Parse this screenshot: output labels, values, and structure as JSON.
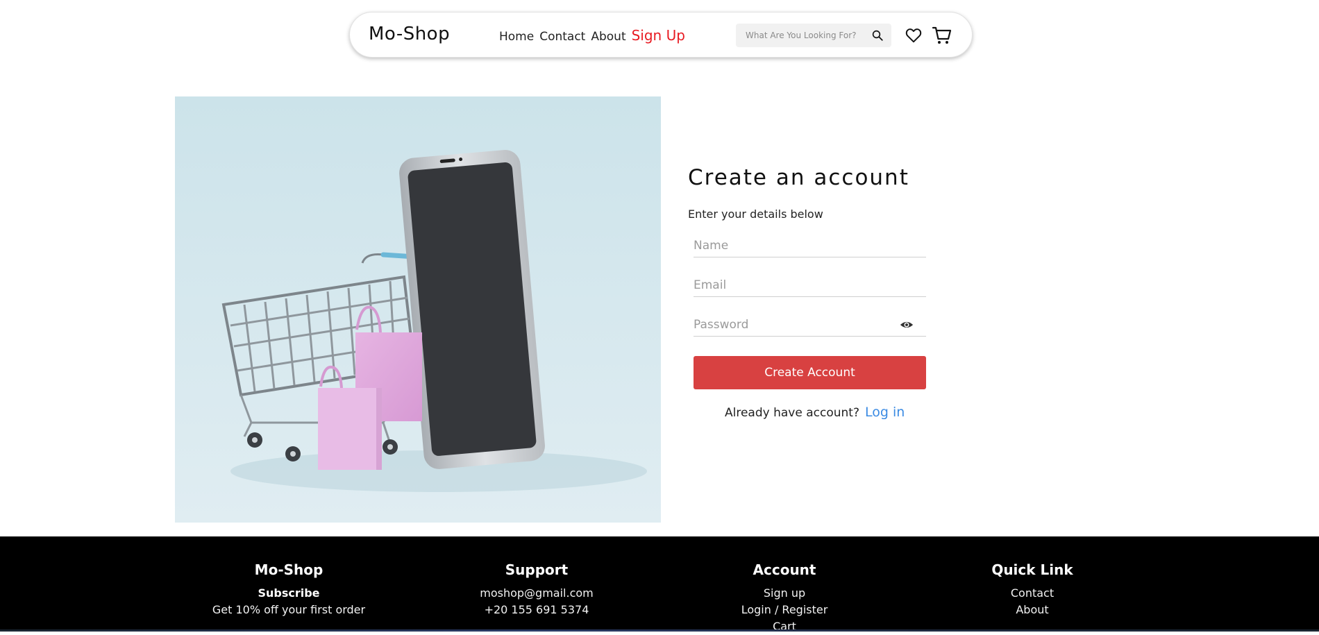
{
  "nav": {
    "brand": "Mo-Shop",
    "links": [
      {
        "label": "Home"
      },
      {
        "label": "Contact"
      },
      {
        "label": "About"
      },
      {
        "label": "Sign Up",
        "active": true
      }
    ],
    "search": {
      "placeholder": "What Are You Looking For?",
      "value": ""
    },
    "icons": [
      "search-icon",
      "heart-icon",
      "cart-icon"
    ]
  },
  "hero": {
    "image_subject": "shopping cart with smartphone and pink shopping bags"
  },
  "form": {
    "title": "Create an account",
    "subtitle": "Enter your details below",
    "fields": {
      "name": {
        "placeholder": "Name",
        "value": ""
      },
      "email": {
        "placeholder": "Email",
        "value": ""
      },
      "password": {
        "placeholder": "Password",
        "value": ""
      }
    },
    "submit_label": "Create Account",
    "login_prompt": "Already have account?",
    "login_link": "Log in"
  },
  "footer": {
    "columns": [
      {
        "title": "Mo-Shop",
        "lines": [
          "Subscribe",
          "Get 10% off your first order"
        ]
      },
      {
        "title": "Support",
        "lines": [
          "moshop@gmail.com",
          "+20 155 691 5374"
        ]
      },
      {
        "title": "Account",
        "lines": [
          "Sign up",
          "Login / Register",
          "Cart"
        ]
      },
      {
        "title": "Quick Link",
        "lines": [
          "Contact",
          "About"
        ]
      }
    ]
  },
  "colors": {
    "accent_red": "#e81b22",
    "button_red": "#d84141",
    "link_blue": "#3b8be3",
    "footer_bg": "#000000",
    "hero_bg": "#cfe5eb"
  }
}
